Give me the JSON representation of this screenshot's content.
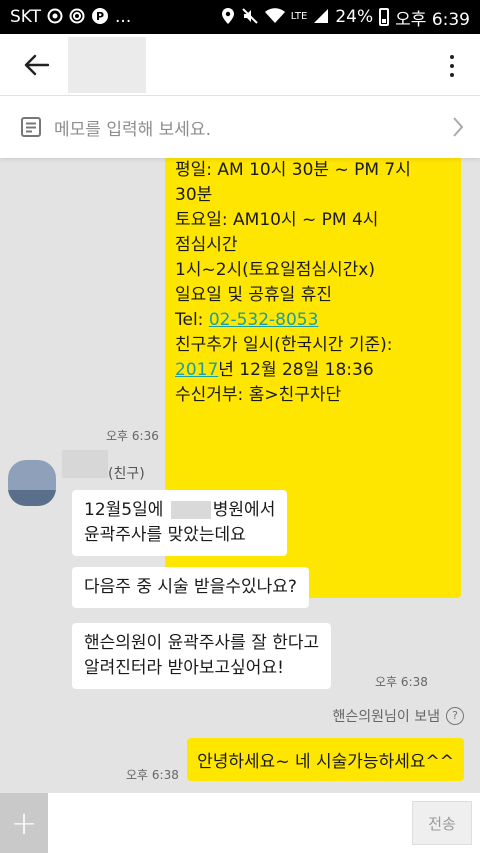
{
  "status_bar": {
    "carrier": "SKT",
    "dots": "...",
    "lte": "LTE",
    "battery": "24%",
    "time": "오후 6:39"
  },
  "memo": {
    "placeholder": "메모를 입력해 보세요."
  },
  "chat": {
    "pharmacy_message": {
      "line1": "평일: AM 10시 30분 ~ PM 7시",
      "line2": "30분",
      "line3": "토요일: AM10시 ~ PM 4시",
      "line4": "점심시간",
      "line5": "1시~2시(토요일점심시간x)",
      "line6": "일요일 및 공휴일 휴진",
      "tel_label": "Tel: ",
      "tel_number": "02-532-8053",
      "added_label": "친구추가 일시(한국시간 기준):",
      "added_year": "2017",
      "added_rest": "년 12월 28일 18:36",
      "block_hint": "수신거부: 홈>친구차단",
      "time": "오후 6:36"
    },
    "friend": {
      "label": "(친구)"
    },
    "friend_messages": [
      {
        "line1_a": "12월5일에 ",
        "line1_b": "병원에서",
        "line2": "윤곽주사를 맞았는데요"
      },
      {
        "text": "다음주 중 시술 받을수있나요?"
      },
      {
        "line1": "핸슨의원이 윤곽주사를 잘 한다고",
        "line2": "알려진터라 받아보고싶어요!"
      }
    ],
    "friend_time": "오후 6:38",
    "sender_label": "핸슨의원님이 보냄",
    "reply": {
      "text": "안녕하세요~ 네 시술가능하세요^^",
      "time": "오후 6:38"
    }
  },
  "input": {
    "send_label": "전송",
    "plus": "+"
  },
  "colors": {
    "yellow": "#ffe600",
    "link": "#1aa0a0",
    "background": "#e3e3e3"
  }
}
